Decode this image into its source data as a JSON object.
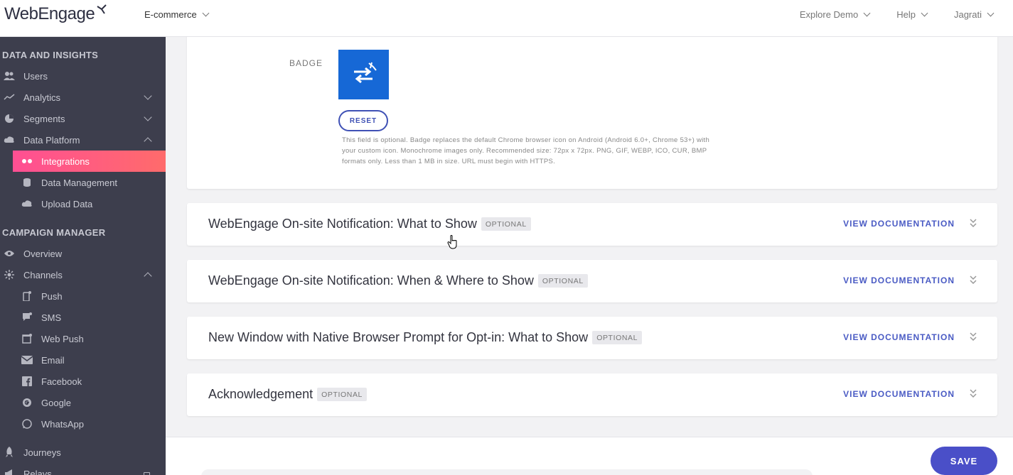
{
  "topbar": {
    "logo": "WebEngage",
    "project": "E-commerce",
    "nav": [
      "Explore Demo",
      "Help",
      "Jagrati"
    ]
  },
  "sidebar": {
    "section1": "DATA AND INSIGHTS",
    "section2": "CAMPAIGN MANAGER",
    "items": {
      "users": "Users",
      "analytics": "Analytics",
      "segments": "Segments",
      "data_platform": "Data Platform",
      "integrations": "Integrations",
      "data_management": "Data Management",
      "upload_data": "Upload Data",
      "overview": "Overview",
      "channels": "Channels",
      "push": "Push",
      "sms": "SMS",
      "web_push": "Web Push",
      "email": "Email",
      "facebook": "Facebook",
      "google": "Google",
      "whatsapp": "WhatsApp",
      "journeys": "Journeys",
      "relays": "Relays"
    }
  },
  "badge": {
    "label": "BADGE",
    "reset": "RESET",
    "help": "This field is optional. Badge replaces the default Chrome browser icon on Android (Android 6.0+, Chrome 53+) with your custom icon. Monochrome images only. Recommended size: 72px x 72px. PNG, GIF, WEBP, ICO, CUR, BMP formats only. Less than 1 MB in size. URL must begin with HTTPS."
  },
  "sections": [
    {
      "title": "WebEngage On-site Notification: What to Show",
      "tag": "OPTIONAL",
      "link": "VIEW DOCUMENTATION"
    },
    {
      "title": "WebEngage On-site Notification: When & Where to Show",
      "tag": "OPTIONAL",
      "link": "VIEW DOCUMENTATION"
    },
    {
      "title": "New Window with Native Browser Prompt for Opt-in: What to Show",
      "tag": "OPTIONAL",
      "link": "VIEW DOCUMENTATION"
    },
    {
      "title": "Acknowledgement",
      "tag": "OPTIONAL",
      "link": "VIEW DOCUMENTATION"
    }
  ],
  "footer": {
    "save": "SAVE"
  },
  "colors": {
    "accent": "#4a4fc8",
    "active_nav": "#ff4f93",
    "sidebar": "#3d3e4d",
    "badge_bg": "#1668d6"
  }
}
